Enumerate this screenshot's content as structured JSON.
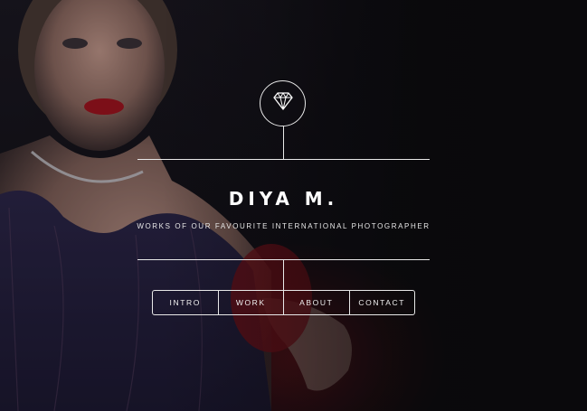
{
  "header": {
    "logo_icon": "diamond-icon",
    "title": "DIYA M.",
    "subtitle": "WORKS OF OUR FAVOURITE INTERNATIONAL PHOTOGRAPHER"
  },
  "nav": {
    "items": [
      {
        "label": "INTRO"
      },
      {
        "label": "WORK"
      },
      {
        "label": "ABOUT"
      },
      {
        "label": "CONTACT"
      }
    ]
  },
  "colors": {
    "background": "#0b0a0d",
    "line": "#e8e8e8",
    "text": "#ffffff",
    "accent_red": "#b3121a"
  }
}
